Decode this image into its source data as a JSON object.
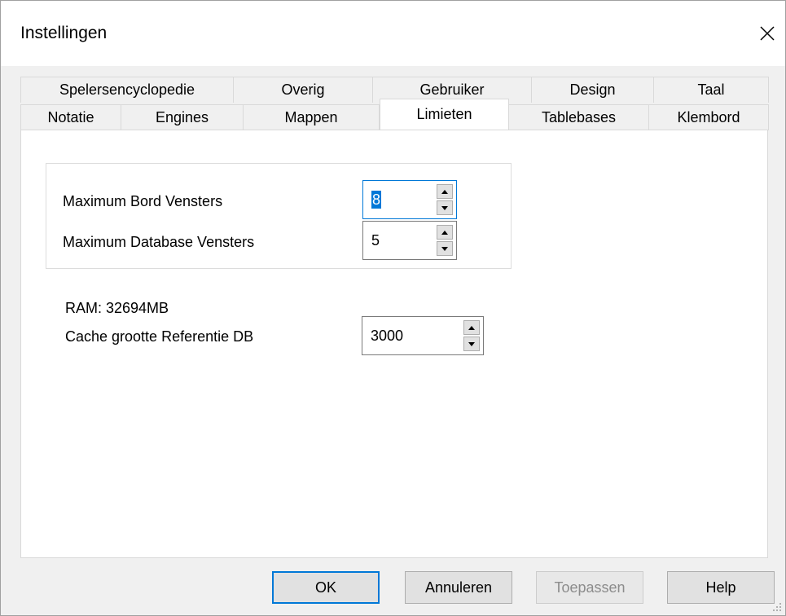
{
  "window": {
    "title": "Instellingen",
    "close_icon": "close-icon"
  },
  "tabs": {
    "back_row": [
      "Spelersencyclopedie",
      "Overig",
      "Gebruiker",
      "Design",
      "Taal"
    ],
    "front_row": [
      "Notatie",
      "Engines",
      "Mappen",
      "Limieten",
      "Tablebases",
      "Klembord"
    ],
    "selected": "Limieten"
  },
  "limits": {
    "max_board_windows": {
      "label": "Maximum Bord Vensters",
      "value": "8"
    },
    "max_database_windows": {
      "label": "Maximum Database Vensters",
      "value": "5"
    },
    "ram": "RAM: 32694MB",
    "cache": {
      "label": "Cache grootte Referentie DB",
      "value": "3000"
    }
  },
  "buttons": {
    "ok": "OK",
    "cancel": "Annuleren",
    "apply": "Toepassen",
    "help": "Help"
  },
  "colors": {
    "accent": "#0078d7",
    "panel": "#ffffff",
    "background": "#f0f0f0"
  }
}
